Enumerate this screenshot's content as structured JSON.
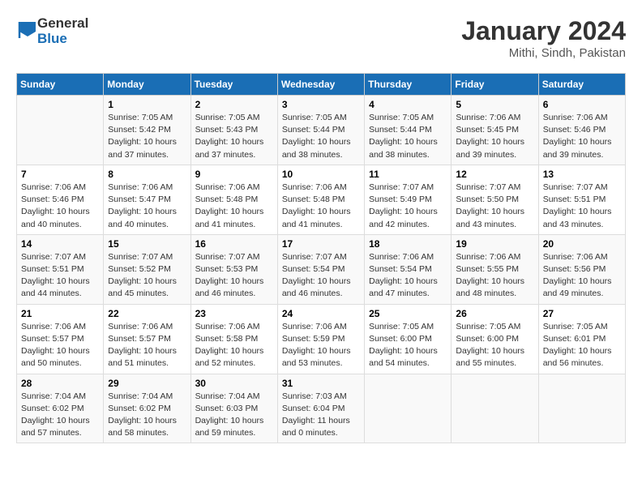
{
  "header": {
    "logo_general": "General",
    "logo_blue": "Blue",
    "month": "January 2024",
    "location": "Mithi, Sindh, Pakistan"
  },
  "days_of_week": [
    "Sunday",
    "Monday",
    "Tuesday",
    "Wednesday",
    "Thursday",
    "Friday",
    "Saturday"
  ],
  "weeks": [
    [
      {
        "day": "",
        "empty": true
      },
      {
        "day": "1",
        "sunrise": "Sunrise: 7:05 AM",
        "sunset": "Sunset: 5:42 PM",
        "daylight": "Daylight: 10 hours and 37 minutes."
      },
      {
        "day": "2",
        "sunrise": "Sunrise: 7:05 AM",
        "sunset": "Sunset: 5:43 PM",
        "daylight": "Daylight: 10 hours and 37 minutes."
      },
      {
        "day": "3",
        "sunrise": "Sunrise: 7:05 AM",
        "sunset": "Sunset: 5:44 PM",
        "daylight": "Daylight: 10 hours and 38 minutes."
      },
      {
        "day": "4",
        "sunrise": "Sunrise: 7:05 AM",
        "sunset": "Sunset: 5:44 PM",
        "daylight": "Daylight: 10 hours and 38 minutes."
      },
      {
        "day": "5",
        "sunrise": "Sunrise: 7:06 AM",
        "sunset": "Sunset: 5:45 PM",
        "daylight": "Daylight: 10 hours and 39 minutes."
      },
      {
        "day": "6",
        "sunrise": "Sunrise: 7:06 AM",
        "sunset": "Sunset: 5:46 PM",
        "daylight": "Daylight: 10 hours and 39 minutes."
      }
    ],
    [
      {
        "day": "7",
        "sunrise": "Sunrise: 7:06 AM",
        "sunset": "Sunset: 5:46 PM",
        "daylight": "Daylight: 10 hours and 40 minutes."
      },
      {
        "day": "8",
        "sunrise": "Sunrise: 7:06 AM",
        "sunset": "Sunset: 5:47 PM",
        "daylight": "Daylight: 10 hours and 40 minutes."
      },
      {
        "day": "9",
        "sunrise": "Sunrise: 7:06 AM",
        "sunset": "Sunset: 5:48 PM",
        "daylight": "Daylight: 10 hours and 41 minutes."
      },
      {
        "day": "10",
        "sunrise": "Sunrise: 7:06 AM",
        "sunset": "Sunset: 5:48 PM",
        "daylight": "Daylight: 10 hours and 41 minutes."
      },
      {
        "day": "11",
        "sunrise": "Sunrise: 7:07 AM",
        "sunset": "Sunset: 5:49 PM",
        "daylight": "Daylight: 10 hours and 42 minutes."
      },
      {
        "day": "12",
        "sunrise": "Sunrise: 7:07 AM",
        "sunset": "Sunset: 5:50 PM",
        "daylight": "Daylight: 10 hours and 43 minutes."
      },
      {
        "day": "13",
        "sunrise": "Sunrise: 7:07 AM",
        "sunset": "Sunset: 5:51 PM",
        "daylight": "Daylight: 10 hours and 43 minutes."
      }
    ],
    [
      {
        "day": "14",
        "sunrise": "Sunrise: 7:07 AM",
        "sunset": "Sunset: 5:51 PM",
        "daylight": "Daylight: 10 hours and 44 minutes."
      },
      {
        "day": "15",
        "sunrise": "Sunrise: 7:07 AM",
        "sunset": "Sunset: 5:52 PM",
        "daylight": "Daylight: 10 hours and 45 minutes."
      },
      {
        "day": "16",
        "sunrise": "Sunrise: 7:07 AM",
        "sunset": "Sunset: 5:53 PM",
        "daylight": "Daylight: 10 hours and 46 minutes."
      },
      {
        "day": "17",
        "sunrise": "Sunrise: 7:07 AM",
        "sunset": "Sunset: 5:54 PM",
        "daylight": "Daylight: 10 hours and 46 minutes."
      },
      {
        "day": "18",
        "sunrise": "Sunrise: 7:06 AM",
        "sunset": "Sunset: 5:54 PM",
        "daylight": "Daylight: 10 hours and 47 minutes."
      },
      {
        "day": "19",
        "sunrise": "Sunrise: 7:06 AM",
        "sunset": "Sunset: 5:55 PM",
        "daylight": "Daylight: 10 hours and 48 minutes."
      },
      {
        "day": "20",
        "sunrise": "Sunrise: 7:06 AM",
        "sunset": "Sunset: 5:56 PM",
        "daylight": "Daylight: 10 hours and 49 minutes."
      }
    ],
    [
      {
        "day": "21",
        "sunrise": "Sunrise: 7:06 AM",
        "sunset": "Sunset: 5:57 PM",
        "daylight": "Daylight: 10 hours and 50 minutes."
      },
      {
        "day": "22",
        "sunrise": "Sunrise: 7:06 AM",
        "sunset": "Sunset: 5:57 PM",
        "daylight": "Daylight: 10 hours and 51 minutes."
      },
      {
        "day": "23",
        "sunrise": "Sunrise: 7:06 AM",
        "sunset": "Sunset: 5:58 PM",
        "daylight": "Daylight: 10 hours and 52 minutes."
      },
      {
        "day": "24",
        "sunrise": "Sunrise: 7:06 AM",
        "sunset": "Sunset: 5:59 PM",
        "daylight": "Daylight: 10 hours and 53 minutes."
      },
      {
        "day": "25",
        "sunrise": "Sunrise: 7:05 AM",
        "sunset": "Sunset: 6:00 PM",
        "daylight": "Daylight: 10 hours and 54 minutes."
      },
      {
        "day": "26",
        "sunrise": "Sunrise: 7:05 AM",
        "sunset": "Sunset: 6:00 PM",
        "daylight": "Daylight: 10 hours and 55 minutes."
      },
      {
        "day": "27",
        "sunrise": "Sunrise: 7:05 AM",
        "sunset": "Sunset: 6:01 PM",
        "daylight": "Daylight: 10 hours and 56 minutes."
      }
    ],
    [
      {
        "day": "28",
        "sunrise": "Sunrise: 7:04 AM",
        "sunset": "Sunset: 6:02 PM",
        "daylight": "Daylight: 10 hours and 57 minutes."
      },
      {
        "day": "29",
        "sunrise": "Sunrise: 7:04 AM",
        "sunset": "Sunset: 6:02 PM",
        "daylight": "Daylight: 10 hours and 58 minutes."
      },
      {
        "day": "30",
        "sunrise": "Sunrise: 7:04 AM",
        "sunset": "Sunset: 6:03 PM",
        "daylight": "Daylight: 10 hours and 59 minutes."
      },
      {
        "day": "31",
        "sunrise": "Sunrise: 7:03 AM",
        "sunset": "Sunset: 6:04 PM",
        "daylight": "Daylight: 11 hours and 0 minutes."
      },
      {
        "day": "",
        "empty": true
      },
      {
        "day": "",
        "empty": true
      },
      {
        "day": "",
        "empty": true
      }
    ]
  ]
}
